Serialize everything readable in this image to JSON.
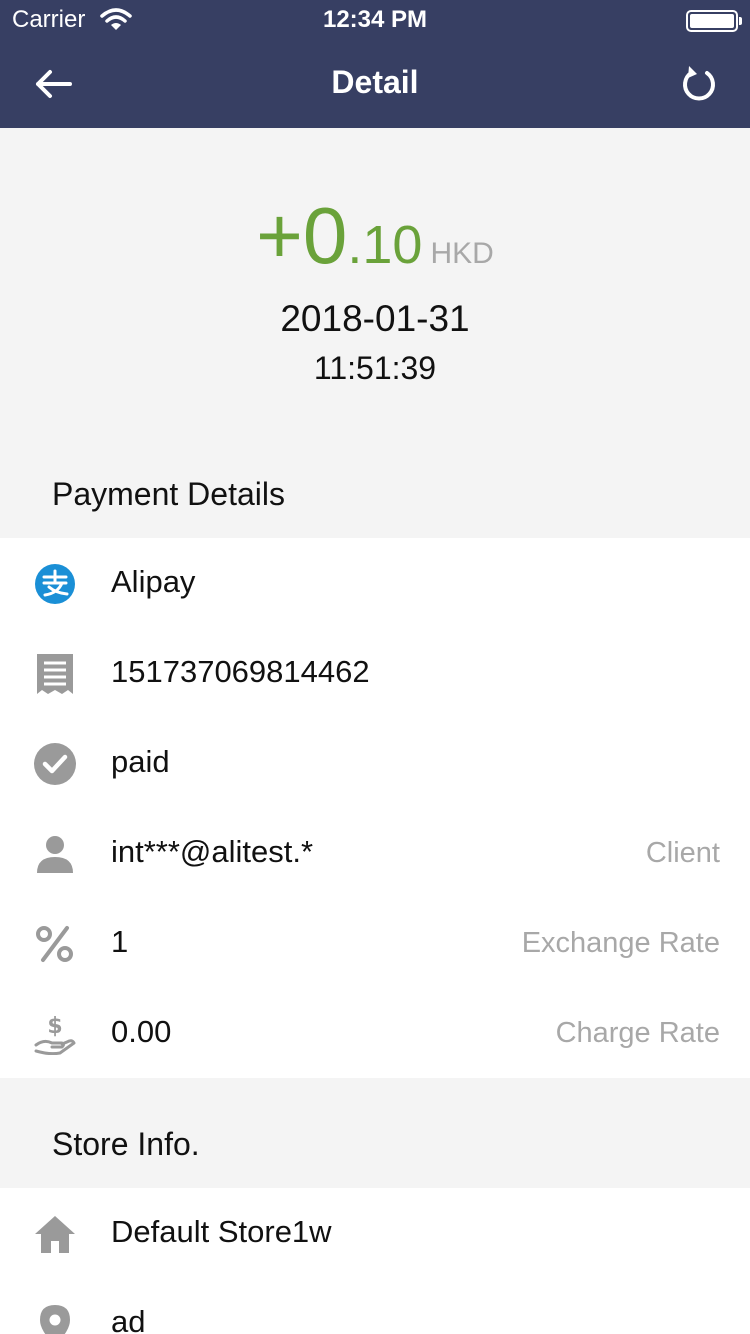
{
  "status": {
    "carrier": "Carrier",
    "time": "12:34 PM"
  },
  "nav": {
    "title": "Detail",
    "back_icon": "back-arrow-icon",
    "refresh_icon": "refresh-icon"
  },
  "amount": {
    "sign_int": "+0",
    "decimal": ".10",
    "currency": "HKD",
    "color": "#6aa23a"
  },
  "datetime": {
    "date": "2018-01-31",
    "time": "11:51:39"
  },
  "payment": {
    "title": "Payment Details",
    "method": "Alipay",
    "order_no": "151737069814462",
    "status": "paid",
    "client_value": "int***@alitest.*",
    "client_label": "Client",
    "exchange_value": "1",
    "exchange_label": "Exchange Rate",
    "charge_value": "0.00",
    "charge_label": "Charge Rate"
  },
  "store": {
    "title": "Store Info.",
    "name": "Default Store1w",
    "address": "ad"
  },
  "colors": {
    "nav_bg": "#373f63",
    "accent_green": "#6aa23a",
    "alipay_blue": "#1a8fd6",
    "icon_gray": "#9a9a9a"
  }
}
